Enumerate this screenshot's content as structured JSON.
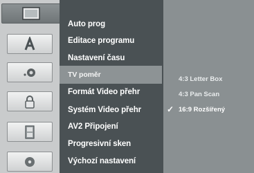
{
  "menu": {
    "items": [
      {
        "label": "Auto prog"
      },
      {
        "label": "Editace programu"
      },
      {
        "label": "Nastavení času"
      },
      {
        "label": "TV poměr"
      },
      {
        "label": "Formát Video přehr"
      },
      {
        "label": "Systém Video přehr"
      },
      {
        "label": "AV2 Připojení"
      },
      {
        "label": "Progresivní sken"
      },
      {
        "label": "Výchozí nastavení"
      }
    ],
    "highlighted_index": 3
  },
  "options": {
    "items": [
      {
        "label": "4:3 Letter Box",
        "selected": false
      },
      {
        "label": "4:3 Pan Scan",
        "selected": false
      },
      {
        "label": "16:9 Rozšířený",
        "selected": true
      }
    ],
    "check_glyph": "✓"
  },
  "icons": [
    {
      "name": "tv-setup-icon",
      "active": true
    },
    {
      "name": "language-icon",
      "active": false
    },
    {
      "name": "audio-icon",
      "active": false
    },
    {
      "name": "lock-icon",
      "active": false
    },
    {
      "name": "film-icon",
      "active": false
    },
    {
      "name": "disc-icon",
      "active": false
    }
  ],
  "colors": {
    "menu_bg": "#4a5154",
    "highlight": "#8d9395",
    "options_bg": "#8a9092"
  }
}
